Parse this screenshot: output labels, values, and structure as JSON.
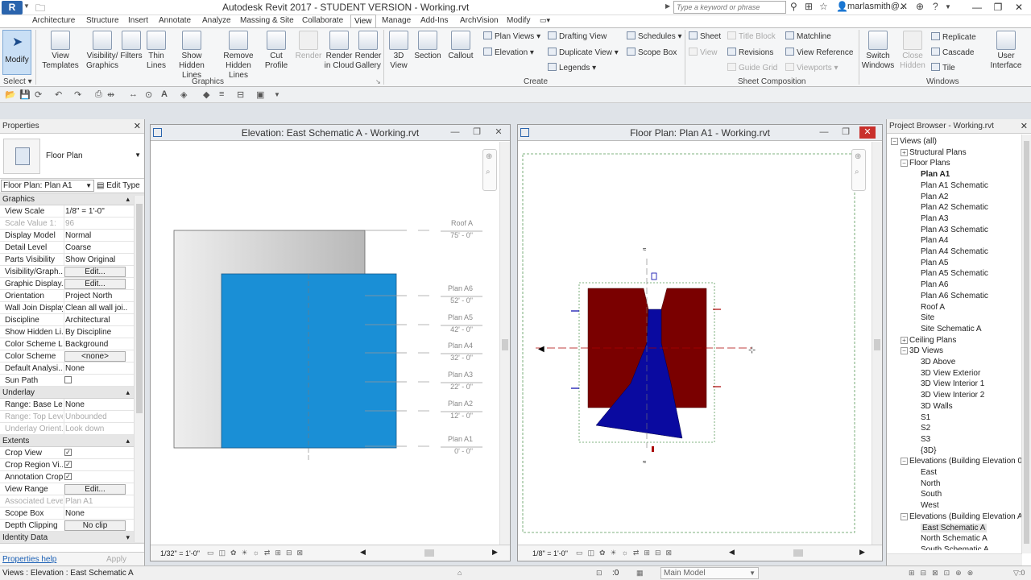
{
  "app": {
    "logo_letter": "R",
    "title": "Autodesk Revit 2017 - STUDENT VERSION -     Working.rvt",
    "search_placeholder": "Type a keyword or phrase",
    "username": "marlasmith@...",
    "minimize": "—",
    "restore": "❐",
    "close": "✕"
  },
  "ribbon": {
    "tabs": [
      "Architecture",
      "Structure",
      "Insert",
      "Annotate",
      "Analyze",
      "Massing & Site",
      "Collaborate",
      "View",
      "Manage",
      "Add-Ins",
      "ArchVision",
      "Modify"
    ],
    "active_tab": "View",
    "modify_label": "Modify",
    "select_label": "Select ▾",
    "graphics": {
      "label": "Graphics",
      "buttons": [
        "View Templates",
        "Visibility/ Graphics",
        "Filters",
        "Thin Lines",
        "Show Hidden Lines",
        "Remove Hidden Lines",
        "Cut Profile"
      ]
    },
    "presentation": {
      "buttons": [
        "Render",
        "Render in Cloud",
        "Render Gallery"
      ]
    },
    "create": {
      "label": "Create",
      "buttons": [
        "3D View",
        "Section",
        "Callout"
      ],
      "small": [
        "Plan Views ▾",
        "Elevation ▾",
        "Drafting  View",
        "Duplicate  View ▾",
        "Legends ▾",
        "Schedules ▾",
        "Scope  Box"
      ]
    },
    "sheet_composition": {
      "label": "Sheet Composition",
      "small": [
        "Sheet",
        "Title  Block",
        "Matchline",
        "View",
        "Revisions",
        "View Reference",
        "Guide  Grid",
        "Viewports ▾"
      ]
    },
    "windows": {
      "label": "Windows",
      "buttons": [
        "Switch Windows",
        "Close Hidden",
        "User Interface"
      ],
      "small": [
        "Replicate",
        "Cascade",
        "Tile"
      ]
    }
  },
  "properties": {
    "header": "Properties",
    "type_name": "Floor Plan",
    "instance": "Floor Plan: Plan A1",
    "edit_type": "Edit Type",
    "sections": [
      {
        "title": "Graphics",
        "rows": [
          {
            "name": "View Scale",
            "value": "1/8\" = 1'-0\""
          },
          {
            "name": "Scale Value    1:",
            "value": "96",
            "dim": true
          },
          {
            "name": "Display Model",
            "value": "Normal"
          },
          {
            "name": "Detail Level",
            "value": "Coarse"
          },
          {
            "name": "Parts Visibility",
            "value": "Show Original"
          },
          {
            "name": "Visibility/Graph...",
            "value": "Edit...",
            "button": true
          },
          {
            "name": "Graphic Display...",
            "value": "Edit...",
            "button": true
          },
          {
            "name": "Orientation",
            "value": "Project North"
          },
          {
            "name": "Wall Join Display",
            "value": "Clean all wall joi..."
          },
          {
            "name": "Discipline",
            "value": "Architectural"
          },
          {
            "name": "Show Hidden Li...",
            "value": "By Discipline"
          },
          {
            "name": "Color Scheme L...",
            "value": "Background"
          },
          {
            "name": "Color Scheme",
            "value": "<none>",
            "button": true
          },
          {
            "name": "Default Analysi...",
            "value": "None"
          },
          {
            "name": "Sun Path",
            "value": "",
            "check": false
          }
        ]
      },
      {
        "title": "Underlay",
        "rows": [
          {
            "name": "Range: Base Le...",
            "value": "None"
          },
          {
            "name": "Range: Top Level",
            "value": "Unbounded",
            "dim": true
          },
          {
            "name": "Underlay Orient...",
            "value": "Look down",
            "dim": true
          }
        ]
      },
      {
        "title": "Extents",
        "rows": [
          {
            "name": "Crop View",
            "value": "",
            "check": true
          },
          {
            "name": "Crop Region Vi...",
            "value": "",
            "check": true
          },
          {
            "name": "Annotation Crop",
            "value": "",
            "check": true
          },
          {
            "name": "View Range",
            "value": "Edit...",
            "button": true
          },
          {
            "name": "Associated Level",
            "value": "Plan A1",
            "dim": true
          },
          {
            "name": "Scope Box",
            "value": "None"
          },
          {
            "name": "Depth Clipping",
            "value": "No clip",
            "button": true
          }
        ]
      },
      {
        "title": "Identity Data",
        "rows": []
      }
    ],
    "help_link": "Properties help",
    "apply": "Apply"
  },
  "elevation_view": {
    "title": "Elevation: East Schematic A - Working.rvt",
    "scale": "1/32\" = 1'-0\"",
    "levels": [
      {
        "name": "Roof A",
        "elev": "75' - 0\""
      },
      {
        "name": "Plan A6",
        "elev": "52' - 0\""
      },
      {
        "name": "Plan A5",
        "elev": "42' - 0\""
      },
      {
        "name": "Plan A4",
        "elev": "32' - 0\""
      },
      {
        "name": "Plan A3",
        "elev": "22' - 0\""
      },
      {
        "name": "Plan A2",
        "elev": "12' - 0\""
      },
      {
        "name": "Plan A1",
        "elev": "0' - 0\""
      }
    ],
    "colors": {
      "grey": "#c8c8c8",
      "blue": "#1a8fd6"
    }
  },
  "plan_view": {
    "title": "Floor Plan: Plan A1 - Working.rvt",
    "scale": "1/8\" = 1'-0\"",
    "colors": {
      "wall": "#7a0000",
      "core": "#0a0aa0",
      "crop": "#5a9a5a"
    }
  },
  "browser": {
    "header": "Project Browser - Working.rvt",
    "nodes": [
      {
        "label": "Views (all)",
        "level": 0,
        "exp": "−"
      },
      {
        "label": "Structural Plans",
        "level": 1,
        "exp": "+"
      },
      {
        "label": "Floor Plans",
        "level": 1,
        "exp": "−"
      },
      {
        "label": "Plan A1",
        "level": 2,
        "bold": true
      },
      {
        "label": "Plan A1 Schematic",
        "level": 2
      },
      {
        "label": "Plan A2",
        "level": 2
      },
      {
        "label": "Plan A2 Schematic",
        "level": 2
      },
      {
        "label": "Plan A3",
        "level": 2
      },
      {
        "label": "Plan A3 Schematic",
        "level": 2
      },
      {
        "label": "Plan A4",
        "level": 2
      },
      {
        "label": "Plan A4 Schematic",
        "level": 2
      },
      {
        "label": "Plan A5",
        "level": 2
      },
      {
        "label": "Plan A5 Schematic",
        "level": 2
      },
      {
        "label": "Plan A6",
        "level": 2
      },
      {
        "label": "Plan A6 Schematic",
        "level": 2
      },
      {
        "label": "Roof A",
        "level": 2
      },
      {
        "label": "Site",
        "level": 2
      },
      {
        "label": "Site Schematic A",
        "level": 2
      },
      {
        "label": "Ceiling Plans",
        "level": 1,
        "exp": "+"
      },
      {
        "label": "3D Views",
        "level": 1,
        "exp": "−"
      },
      {
        "label": "3D Above",
        "level": 2
      },
      {
        "label": "3D View Exterior",
        "level": 2
      },
      {
        "label": "3D View Interior 1",
        "level": 2
      },
      {
        "label": "3D View Interior 2",
        "level": 2
      },
      {
        "label": "3D Walls",
        "level": 2
      },
      {
        "label": "S1",
        "level": 2
      },
      {
        "label": "S2",
        "level": 2
      },
      {
        "label": "S3",
        "level": 2
      },
      {
        "label": "{3D}",
        "level": 2
      },
      {
        "label": "Elevations (Building Elevation 0",
        "level": 1,
        "exp": "−"
      },
      {
        "label": "East",
        "level": 2
      },
      {
        "label": "North",
        "level": 2
      },
      {
        "label": "South",
        "level": 2
      },
      {
        "label": "West",
        "level": 2
      },
      {
        "label": "Elevations (Building Elevation A",
        "level": 1,
        "exp": "−"
      },
      {
        "label": "East Schematic A",
        "level": 2,
        "selected": true
      },
      {
        "label": "North Schematic A",
        "level": 2
      },
      {
        "label": "South Schematic A",
        "level": 2
      }
    ]
  },
  "status": {
    "text": "Views : Elevation : East Schematic A",
    "zero": ":0",
    "model": "Main Model"
  }
}
